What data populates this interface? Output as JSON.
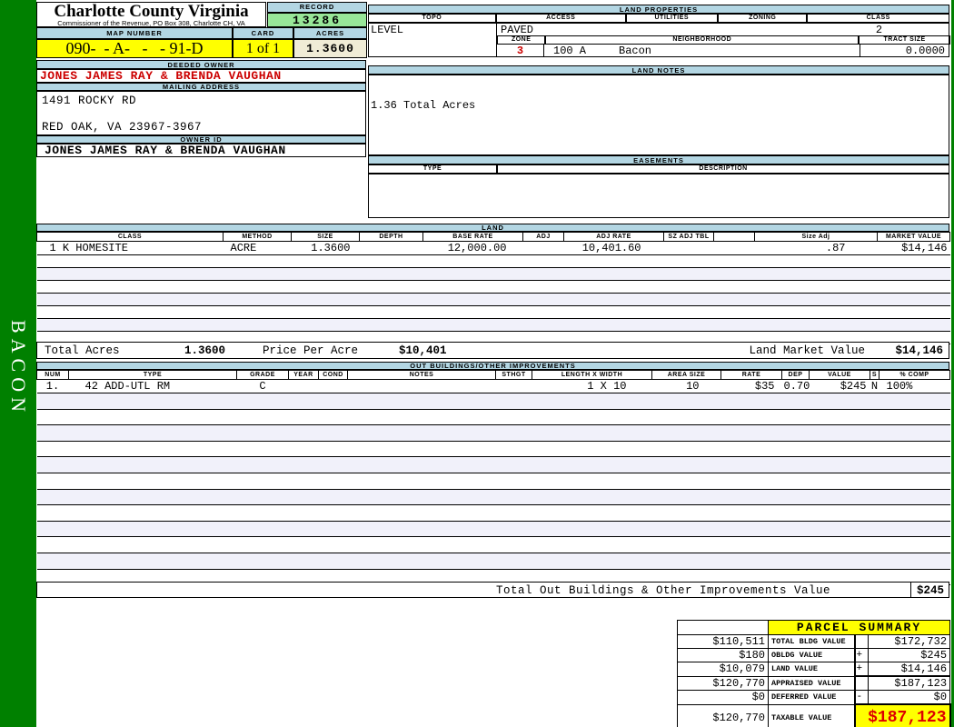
{
  "app": {
    "record_tab": "BACON"
  },
  "header": {
    "county_name": "Charlotte County Virginia",
    "office_line": "Commissioner of the Revenue, PO Box 308, Charlotte CH, VA",
    "record_label": "RECORD",
    "record_number": "13286",
    "map_number_label": "MAP NUMBER",
    "map_number": "090-  - A-   -   - 91-D",
    "card_label": "CARD",
    "card_value": "1 of 1",
    "acres_label": "ACRES",
    "acres_value": "1.3600"
  },
  "owner": {
    "deeded_owner_label": "DEEDED OWNER",
    "deeded_owner": "JONES JAMES RAY & BRENDA VAUGHAN",
    "mailing_address_label": "MAILING ADDRESS",
    "address_line1": "1491 ROCKY RD",
    "address_line2": "RED OAK, VA 23967-3967",
    "owner_id_label": "OWNER ID",
    "owner_id": "JONES JAMES RAY & BRENDA VAUGHAN"
  },
  "land_properties": {
    "title": "LAND PROPERTIES",
    "topo_label": "TOPO",
    "access_label": "ACCESS",
    "utilities_label": "UTILITIES",
    "zoning_label": "ZONING",
    "class_label": "CLASS",
    "topo": "LEVEL",
    "access": "PAVED",
    "utilities": "",
    "zoning": "",
    "class": "2",
    "zone_label": "ZONE",
    "zone": "3",
    "neighborhood_label": "NEIGHBORHOOD",
    "neighborhood_code": "100 A",
    "neighborhood_name": "Bacon",
    "tract_size_label": "TRACT SIZE",
    "tract_size": "0.0000"
  },
  "land_notes": {
    "title": "LAND NOTES",
    "note": "1.36 Total Acres"
  },
  "easements": {
    "title": "EASEMENTS",
    "type_label": "TYPE",
    "description_label": "DESCRIPTION"
  },
  "land": {
    "title": "LAND",
    "headers": [
      "CLASS",
      "METHOD",
      "SIZE",
      "DEPTH",
      "BASE RATE",
      "ADJ",
      "ADJ RATE",
      "SZ ADJ TBL",
      "",
      "Size Adj",
      "MARKET VALUE"
    ],
    "rows": [
      [
        "1 K HOMESITE",
        "ACRE",
        "1.3600",
        "",
        "12,000.00",
        "",
        "10,401.60",
        "",
        "",
        ".87",
        "$14,146"
      ]
    ],
    "totals": {
      "total_acres_label": "Total Acres",
      "total_acres": "1.3600",
      "price_per_acre_label": "Price Per Acre",
      "price_per_acre": "$10,401",
      "land_market_value_label": "Land Market Value",
      "land_market_value": "$14,146"
    }
  },
  "out_buildings": {
    "title": "OUT BUILDINGS/OTHER IMPROVEMENTS",
    "headers": [
      "NUM",
      "TYPE",
      "GRADE",
      "YEAR",
      "COND",
      "NOTES",
      "STHGT",
      "LENGTH X WIDTH",
      "AREA SIZE",
      "RATE",
      "DEP",
      "VALUE",
      "S",
      "% COMP"
    ],
    "rows": [
      [
        "1.",
        "42 ADD-UTL RM",
        "C",
        "",
        "",
        "",
        "",
        "1 X 10",
        "10",
        "$35",
        "0.70",
        "$245",
        "N",
        "100%"
      ]
    ],
    "total_label": "Total Out Buildings & Other Improvements Value",
    "total_value": "$245"
  },
  "parcel_summary": {
    "title": "PARCEL SUMMARY",
    "rows": [
      {
        "prior": "$110,511",
        "label": "TOTAL BLDG VALUE",
        "op": "",
        "value": "$172,732"
      },
      {
        "prior": "$180",
        "label": "OBLDG VALUE",
        "op": "+",
        "value": "$245"
      },
      {
        "prior": "$10,079",
        "label": "LAND VALUE",
        "op": "+",
        "value": "$14,146"
      },
      {
        "prior": "$120,770",
        "label": "APPRAISED VALUE",
        "op": "",
        "value": "$187,123"
      },
      {
        "prior": "$0",
        "label": "DEFERRED VALUE",
        "op": "-",
        "value": "$0"
      }
    ],
    "taxable": {
      "prior": "$120,770",
      "label": "TAXABLE VALUE",
      "value": "$187,123"
    }
  },
  "colors": {
    "frame_green": "#008000",
    "section_bar_blue": "#b3d6e3",
    "record_green": "#98e698",
    "highlight_yellow": "#ffff00",
    "acres_cream": "#f0ecd6",
    "alert_red": "#cc0000"
  }
}
